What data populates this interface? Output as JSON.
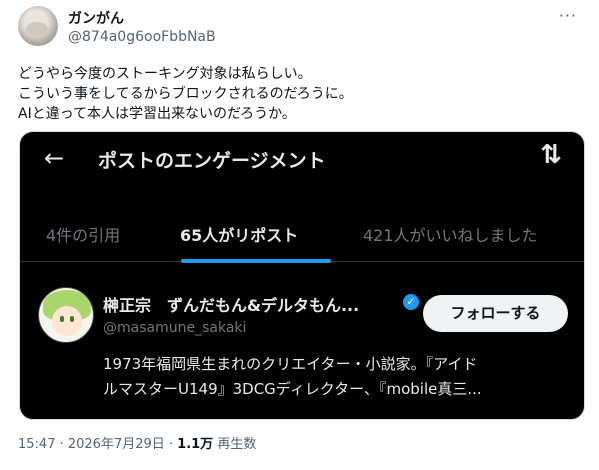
{
  "tweet": {
    "display_name": "ガンがん",
    "handle": "@874a0g6ooFbbNaB",
    "more_label": "···",
    "text_lines": [
      "どうやら今度のストーキング対象は私らしい。",
      "こういう事をしてるからブロックされるのだろうに。",
      "AIと違って本人は学習出来ないのだろうか。"
    ],
    "timestamp": "15:47 · 2026年7月29日 · ",
    "views_count": "1.1万",
    "views_label": " 再生数"
  },
  "screenshot": {
    "back_icon": "arrow-left-icon",
    "back_glyph": "←",
    "title": "ポストのエンゲージメント",
    "sort_icon": "sort-arrows-icon",
    "sort_glyph": "⇅",
    "tabs": [
      {
        "label": "4件の引用",
        "active": false
      },
      {
        "label": "65人がリポスト",
        "active": true
      },
      {
        "label": "421人がいいねしました",
        "active": false
      }
    ],
    "accent_color": "#1d9bf0",
    "user": {
      "name": "榊正宗　ずんだもん&デルタもん...",
      "handle": "@masamune_sakaki",
      "verified_icon": "verified-badge-icon",
      "verified_glyph": "✓",
      "follow_label": "フォローする",
      "bio_lines": [
        "1973年福岡県生まれのクリエイター・小説家。『アイド",
        "ルマスターU149』3DCGディレクター、『mobile真三..."
      ]
    }
  }
}
